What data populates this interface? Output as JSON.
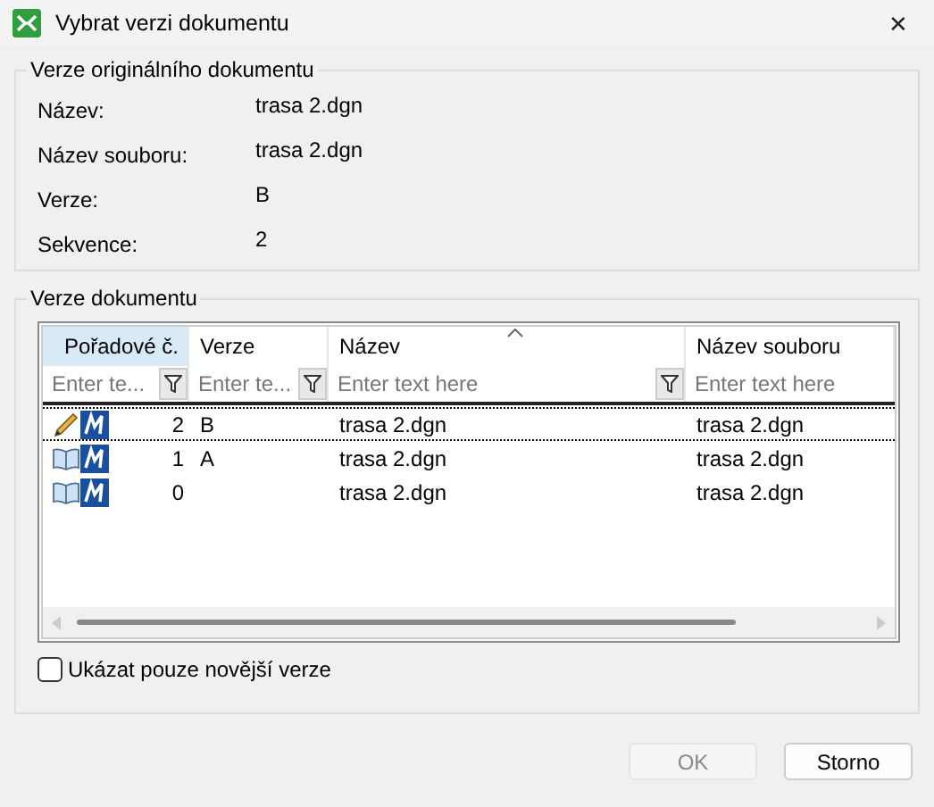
{
  "window": {
    "title": "Vybrat verzi dokumentu",
    "close": "✕"
  },
  "original": {
    "legend": "Verze originálního dokumentu",
    "fields": [
      {
        "label": "Název:",
        "value": "trasa 2.dgn"
      },
      {
        "label": "Název souboru:",
        "value": "trasa 2.dgn"
      },
      {
        "label": "Verze:",
        "value": "B"
      },
      {
        "label": "Sekvence:",
        "value": "2"
      }
    ]
  },
  "versions": {
    "legend": "Verze dokumentu",
    "columns": [
      {
        "label": "Pořadové č.",
        "placeholder": "Enter te...",
        "highlighted": true,
        "sorted": false,
        "filter": true
      },
      {
        "label": "Verze",
        "placeholder": "Enter te...",
        "highlighted": false,
        "sorted": false,
        "filter": true
      },
      {
        "label": "Název",
        "placeholder": "Enter text here",
        "highlighted": false,
        "sorted": true,
        "filter": true
      },
      {
        "label": "Název souboru",
        "placeholder": "Enter text here",
        "highlighted": false,
        "sorted": false,
        "filter": false
      }
    ],
    "rows": [
      {
        "kind": "edit",
        "number": "2",
        "version": "B",
        "name": "trasa 2.dgn",
        "file": "trasa 2.dgn",
        "selected": true
      },
      {
        "kind": "book",
        "number": "1",
        "version": "A",
        "name": "trasa 2.dgn",
        "file": "trasa 2.dgn",
        "selected": false
      },
      {
        "kind": "book",
        "number": "0",
        "version": "",
        "name": "trasa 2.dgn",
        "file": "trasa 2.dgn",
        "selected": false
      }
    ]
  },
  "newer_only": {
    "label": "Ukázat pouze novější verze",
    "checked": false
  },
  "buttons": [
    {
      "label": "OK",
      "disabled": true
    },
    {
      "label": "Storno",
      "disabled": false
    }
  ]
}
